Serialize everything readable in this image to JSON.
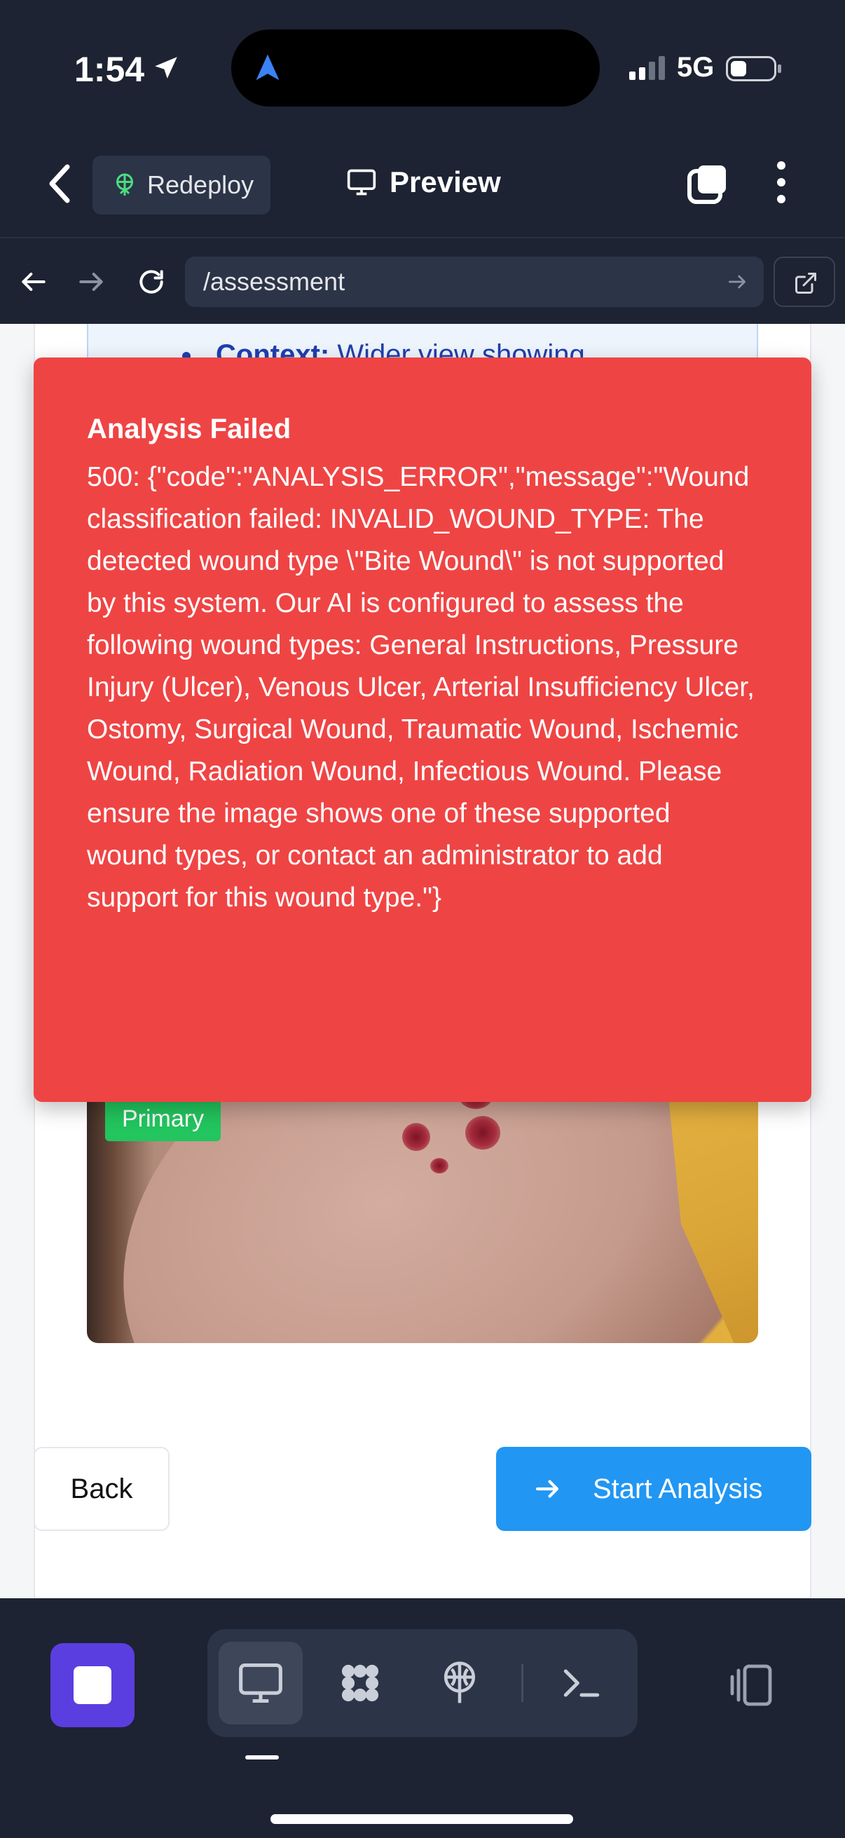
{
  "status_bar": {
    "time": "1:54",
    "network": "5G"
  },
  "app_header": {
    "redeploy_label": "Redeploy",
    "preview_label": "Preview"
  },
  "browser": {
    "url": "/assessment"
  },
  "background_card": {
    "tip_label": "Context:",
    "tip_text": " Wider view showing"
  },
  "photo": {
    "badge": "Primary"
  },
  "actions": {
    "back_label": "Back",
    "start_label": "Start Analysis"
  },
  "error_toast": {
    "title": "Analysis Failed",
    "message": "500: {\"code\":\"ANALYSIS_ERROR\",\"message\":\"Wound classification failed: INVALID_WOUND_TYPE: The detected wound type \\\"Bite Wound\\\" is not supported by this system. Our AI is configured to assess the following wound types: General Instructions, Pressure Injury (Ulcer), Venous Ulcer, Arterial Insufficiency Ulcer, Ostomy, Surgical Wound, Traumatic Wound, Ischemic Wound, Radiation Wound, Infectious Wound. Please ensure the image shows one of these supported wound types, or contact an administrator to add support for this wound type.\"}"
  },
  "colors": {
    "error": "#ef4444",
    "primary": "#2196f3",
    "success": "#22c55e",
    "toolbar": "#1d2332",
    "stop": "#5b3ee0"
  },
  "icons": {
    "status": [
      "location-arrow-icon",
      "app-logo-icon",
      "signal-icon",
      "battery-icon"
    ],
    "header": [
      "back-chevron-icon",
      "redeploy-icon",
      "monitor-icon",
      "tabs-icon",
      "more-icon"
    ],
    "browser": [
      "arrow-left-icon",
      "arrow-right-icon",
      "reload-icon",
      "go-arrow-icon",
      "external-link-icon"
    ],
    "toolbar": [
      "stop-icon",
      "desktop-icon",
      "modules-icon",
      "deploy-icon",
      "terminal-icon",
      "split-view-icon"
    ]
  }
}
